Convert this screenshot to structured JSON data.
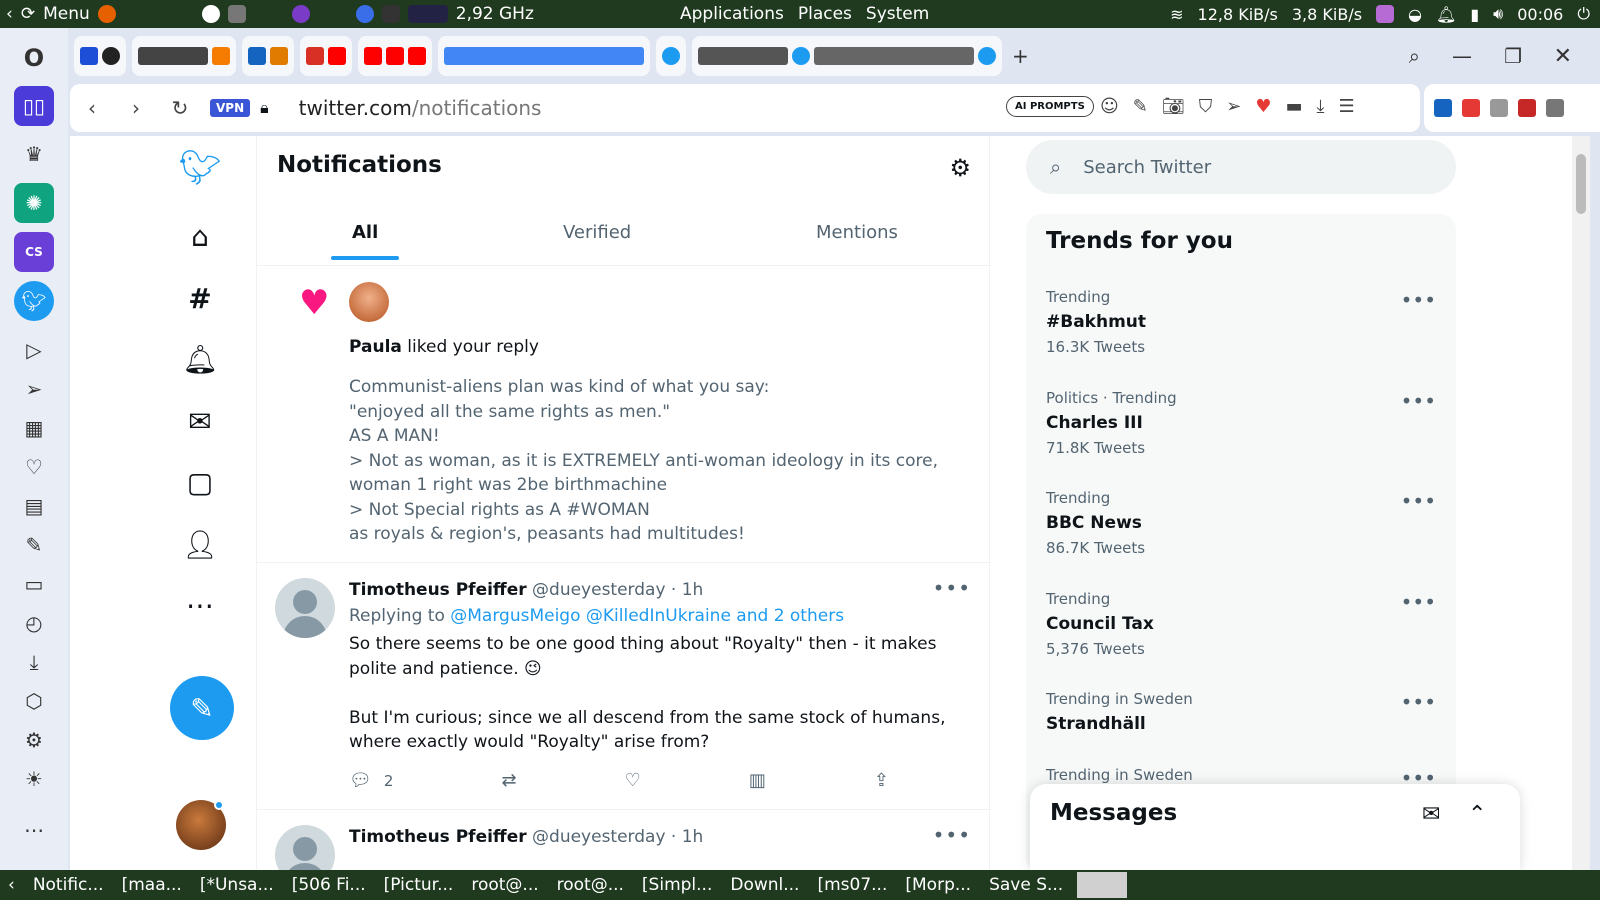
{
  "system_panel": {
    "menu_label": "Menu",
    "cpu": "2,92 GHz",
    "menus": [
      "Applications",
      "Places",
      "System"
    ],
    "net_down": "12,8 KiB/s",
    "net_up": "3,8 KiB/s",
    "clock": "00:06"
  },
  "browser": {
    "url_host": "twitter.com",
    "url_path": "/notifications",
    "vpn_label": "VPN",
    "ai_prompts_label": "AI PROMPTS"
  },
  "twitter": {
    "page_title": "Notifications",
    "tabs": [
      "All",
      "Verified",
      "Mentions"
    ],
    "like_notification": {
      "liker_name": "Paula",
      "action_text": " liked your reply",
      "reply_text": "Communist-aliens plan was kind of what you say:\n\"enjoyed all the same rights as men.\"\nAS A MAN!\n> Not as woman, as it is EXTREMELY anti-woman ideology in its core, woman 1 right was 2be birthmachine\n> Not Special rights as A #WOMAN\nas royals & region's, peasants had multitudes!"
    },
    "tweets": [
      {
        "name": "Timotheus Pfeiffer",
        "handle": "@dueyesterday · 1h",
        "replying_prefix": "Replying to ",
        "replying_to": "@MargusMeigo @KilledInUkraine and 2 others",
        "body": "So there seems to be one good thing about \"Royalty\" then - it makes polite and patience. 😉\n\nBut I'm curious; since we all descend from the same stock of humans, where exactly would \"Royalty\" arise from?",
        "reply_count": "2"
      },
      {
        "name": "Timotheus Pfeiffer",
        "handle": "@dueyesterday · 1h"
      }
    ],
    "search_placeholder": "Search Twitter",
    "trends_title": "Trends for you",
    "trends": [
      {
        "context": "Trending",
        "name": "#Bakhmut",
        "count": "16.3K Tweets"
      },
      {
        "context": "Politics · Trending",
        "name": "Charles III",
        "count": "71.8K Tweets"
      },
      {
        "context": "Trending",
        "name": "BBC News",
        "count": "86.7K Tweets"
      },
      {
        "context": "Trending",
        "name": "Council Tax",
        "count": "5,376 Tweets"
      },
      {
        "context": "Trending in Sweden",
        "name": "Strandhäll",
        "count": ""
      },
      {
        "context": "Trending in Sweden",
        "name": "",
        "count": ""
      }
    ],
    "messages_title": "Messages"
  },
  "taskbar": {
    "items": [
      "Notific...",
      "[maa...",
      "[*Unsa...",
      "[506 Fi...",
      "[Pictur...",
      "root@...",
      "root@...",
      "[Simpl...",
      "Downl...",
      "[ms07...",
      "[Morp...",
      "Save S..."
    ]
  },
  "colors": {
    "twitter_blue": "#1d9bf0",
    "like_pink": "#f91880",
    "panel_green": "#1f3a1f"
  }
}
